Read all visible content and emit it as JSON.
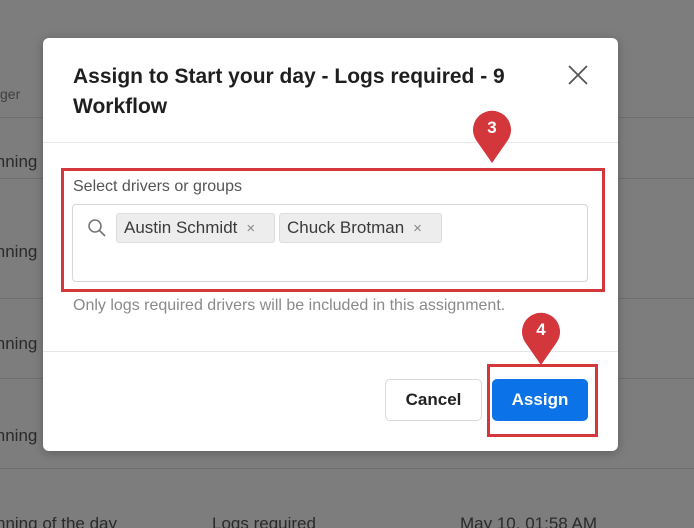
{
  "background": {
    "column_header_fragment": "ger",
    "rows": [
      {
        "col1": "inning"
      },
      {
        "col1": "inning"
      },
      {
        "col1": "inning"
      },
      {
        "col1": "inning"
      },
      {
        "col1": "nning of the day",
        "col2": "Logs required",
        "col3": "May 10, 01:58 AM"
      }
    ]
  },
  "modal": {
    "title": "Assign to Start your day - Logs required - 9 Workflow",
    "field_label": "Select drivers or groups",
    "selected": [
      {
        "label": "Austin Schmidt",
        "remove": "×"
      },
      {
        "label": "Chuck Brotman",
        "remove": "×"
      }
    ],
    "help_text": "Only logs required drivers will be included in this assignment.",
    "cancel_label": "Cancel",
    "assign_label": "Assign"
  },
  "annotations": {
    "marker_3": "3",
    "marker_4": "4",
    "color": "#d3363b"
  },
  "colors": {
    "primary": "#0b72e7",
    "overlay": "#7d7d7d"
  }
}
